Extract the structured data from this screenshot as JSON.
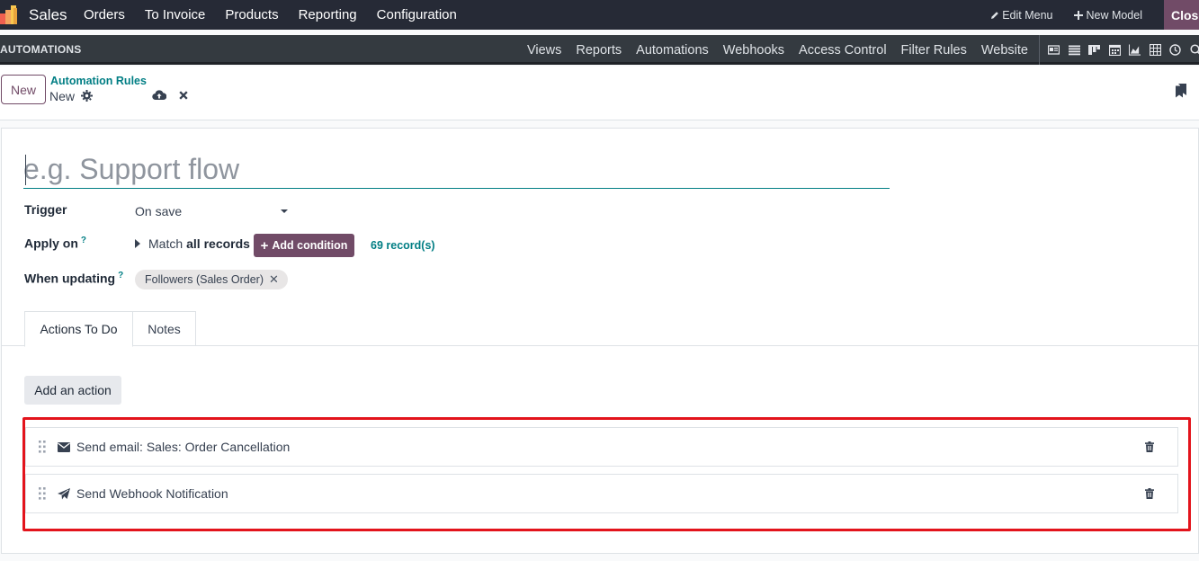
{
  "topbar": {
    "app_name": "Sales",
    "menu": [
      "Orders",
      "To Invoice",
      "Products",
      "Reporting",
      "Configuration"
    ],
    "edit_menu": "Edit Menu",
    "new_model": "New Model",
    "close": "Close"
  },
  "studio": {
    "title": "AUTOMATIONS",
    "menu": [
      "Views",
      "Reports",
      "Automations",
      "Webhooks",
      "Access Control",
      "Filter Rules",
      "Website"
    ],
    "view_icons": [
      "form-view-icon",
      "list-view-icon",
      "kanban-view-icon",
      "calendar-view-icon",
      "graph-view-icon",
      "pivot-view-icon",
      "activity-view-icon",
      "search-view-icon"
    ]
  },
  "control": {
    "new_button": "New",
    "breadcrumb_parent": "Automation Rules",
    "breadcrumb_current": "New"
  },
  "form": {
    "name_placeholder": "e.g. Support flow",
    "trigger_label": "Trigger",
    "trigger_value": "On save",
    "apply_on_label": "Apply on",
    "help_mark": "?",
    "match_prefix": "Match",
    "match_bold": "all records",
    "add_condition": "Add condition",
    "records": "69 record(s)",
    "when_updating_label": "When updating",
    "when_updating_tag": "Followers (Sales Order)"
  },
  "tabs": [
    "Actions To Do",
    "Notes"
  ],
  "actions": {
    "add_button": "Add an action",
    "items": [
      {
        "label": "Send email: Sales: Order Cancellation",
        "icon": "envelope-icon"
      },
      {
        "label": "Send Webhook Notification",
        "icon": "paper-plane-icon"
      }
    ]
  },
  "colors": {
    "brand": "#714b67",
    "accent": "#017e84",
    "topbar": "#262a36",
    "highlight": "#e3141c"
  }
}
